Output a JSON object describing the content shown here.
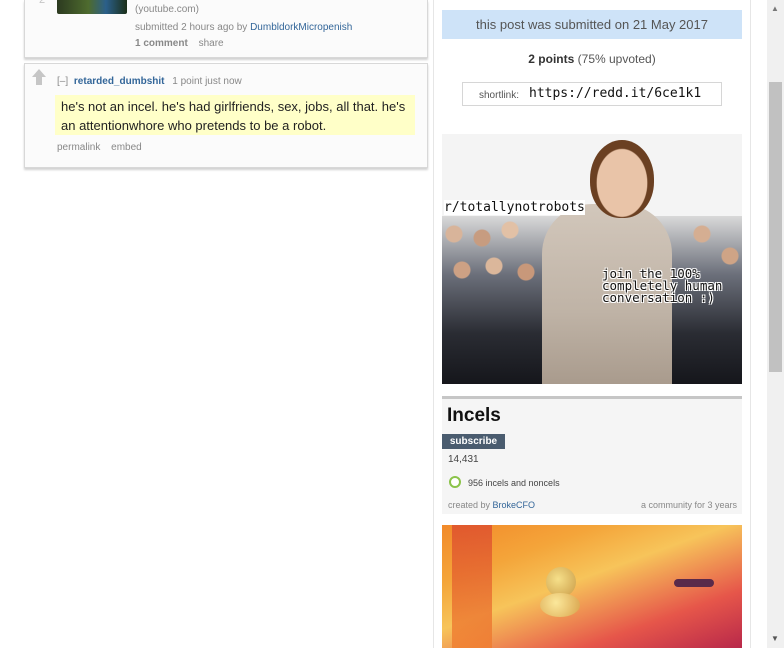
{
  "post": {
    "vote_count": "2",
    "domain": "(youtube.com)",
    "tagline_prefix": "submitted 2 hours ago by",
    "author": "DumbldorkMicropenish",
    "comments_label": "1 comment",
    "share_label": "share"
  },
  "comment": {
    "expand": "[–]",
    "author": "retarded_dumbshit",
    "meta": "1 point just now",
    "body": "he's not an incel. he's had girlfriends, sex, jobs, all that. he's an attentionwhore who pretends to be a robot.",
    "permalink": "permalink",
    "embed": "embed"
  },
  "sidebar": {
    "submitted_text": "this post was submitted on 21 May 2017",
    "points_value": "2 points",
    "points_pct": "(75% upvoted)",
    "shortlink_label": "shortlink:",
    "shortlink_url": "https://redd.it/6ce1k1"
  },
  "banner": {
    "title": "r/totallynotrobots",
    "caption": "join the 100% completely human conversation :)"
  },
  "subreddit": {
    "name": "Incels",
    "subscribe_label": "subscribe",
    "subscribers": "14,431",
    "online": "956 incels and noncels",
    "created_prefix": "created by",
    "creator": "BrokeCFO",
    "age": "a community for 3 years"
  },
  "colors": {
    "link": "#336699",
    "submitted_bg": "#cee3f8",
    "highlight_bg": "#ffffc8",
    "subscribe_bg": "#4a5c6f",
    "online_dot": "#8bc34a"
  },
  "icons": {
    "upvote": "upvote-arrow-icon",
    "online": "online-dot-icon",
    "scroll_up": "scroll-up-icon",
    "scroll_down": "scroll-down-icon"
  }
}
